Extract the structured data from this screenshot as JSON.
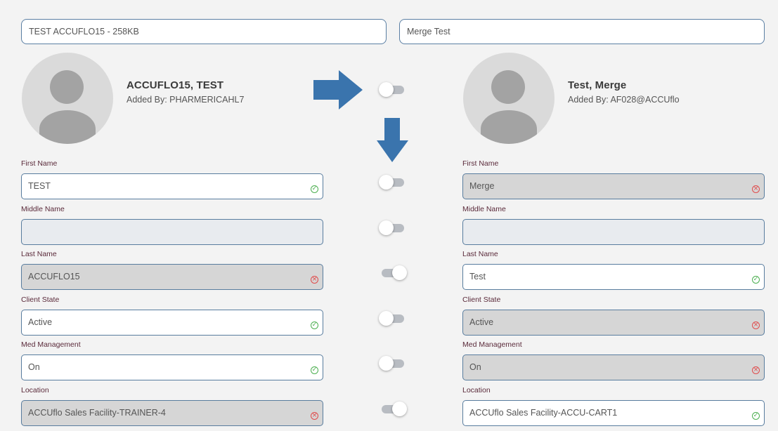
{
  "left_record": {
    "search_value": "TEST ACCUFLO15 - 258KB",
    "name": "ACCUFLO15, TEST",
    "added_by": "Added By: PHARMERICAHL7"
  },
  "right_record": {
    "search_value": "Merge Test",
    "name": "Test, Merge",
    "added_by": "Added By: AF028@ACCUflo"
  },
  "colors": {
    "accent_blue": "#3a74ad",
    "ok_green": "#4caf50",
    "error_red": "#e04b4b"
  },
  "icons": {
    "arrow_right": "arrow-right-icon",
    "arrow_down": "arrow-down-icon",
    "valid": "check-circle-icon",
    "invalid": "x-circle-icon"
  },
  "fields": [
    {
      "label": "First Name",
      "left": {
        "value": "TEST",
        "state": "selected"
      },
      "toggle": "off",
      "right": {
        "value": "Merge",
        "state": "rejected"
      }
    },
    {
      "label": "Middle Name",
      "left": {
        "value": "",
        "state": "empty"
      },
      "toggle": "off",
      "right": {
        "value": "",
        "state": "empty"
      }
    },
    {
      "label": "Last Name",
      "left": {
        "value": "ACCUFLO15",
        "state": "rejected"
      },
      "toggle": "on",
      "right": {
        "value": "Test",
        "state": "selected"
      }
    },
    {
      "label": "Client State",
      "left": {
        "value": "Active",
        "state": "selected"
      },
      "toggle": "off",
      "right": {
        "value": "Active",
        "state": "rejected"
      }
    },
    {
      "label": "Med Management",
      "left": {
        "value": "On",
        "state": "selected"
      },
      "toggle": "off",
      "right": {
        "value": "On",
        "state": "rejected"
      }
    },
    {
      "label": "Location",
      "left": {
        "value": "ACCUflo Sales Facility-TRAINER-4",
        "state": "rejected"
      },
      "toggle": "on",
      "right": {
        "value": "ACCUflo Sales Facility-ACCU-CART1",
        "state": "selected"
      }
    }
  ],
  "header_toggle": "off"
}
